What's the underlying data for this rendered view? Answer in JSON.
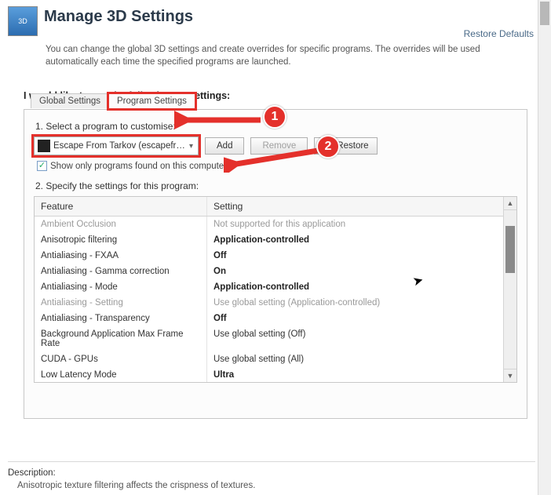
{
  "header": {
    "title": "Manage 3D Settings",
    "restore_defaults": "Restore Defaults",
    "description": "You can change the global 3D settings and create overrides for specific programs. The overrides will be used automatically each time the specified programs are launched."
  },
  "subheading": "I would like to use the following 3D settings:",
  "tabs": {
    "global": "Global Settings",
    "program": "Program Settings"
  },
  "step1": {
    "label": "1. Select a program to customise:",
    "selected": "Escape From Tarkov (escapefro...",
    "add": "Add",
    "remove": "Remove",
    "restore": "Restore"
  },
  "checkbox_label": "Show only programs found on this computer",
  "step2_label": "2. Specify the settings for this program:",
  "columns": {
    "feature": "Feature",
    "setting": "Setting"
  },
  "rows": [
    {
      "f": "Ambient Occlusion",
      "s": "Not supported for this application",
      "dim": true
    },
    {
      "f": "Anisotropic filtering",
      "s": "Application-controlled",
      "bold": true
    },
    {
      "f": "Antialiasing - FXAA",
      "s": "Off",
      "bold": true
    },
    {
      "f": "Antialiasing - Gamma correction",
      "s": "On",
      "bold": true
    },
    {
      "f": "Antialiasing - Mode",
      "s": "Application-controlled",
      "bold": true
    },
    {
      "f": "Antialiasing - Setting",
      "s": "Use global setting (Application-controlled)",
      "dim": true
    },
    {
      "f": "Antialiasing - Transparency",
      "s": "Off",
      "bold": true
    },
    {
      "f": "Background Application Max Frame Rate",
      "s": "Use global setting (Off)"
    },
    {
      "f": "CUDA - GPUs",
      "s": "Use global setting (All)"
    },
    {
      "f": "Low Latency Mode",
      "s": "Ultra",
      "bold": true
    }
  ],
  "footer": {
    "label": "Description:",
    "text": "Anisotropic texture filtering affects the crispness of textures."
  },
  "annotations": {
    "one": "1",
    "two": "2"
  }
}
